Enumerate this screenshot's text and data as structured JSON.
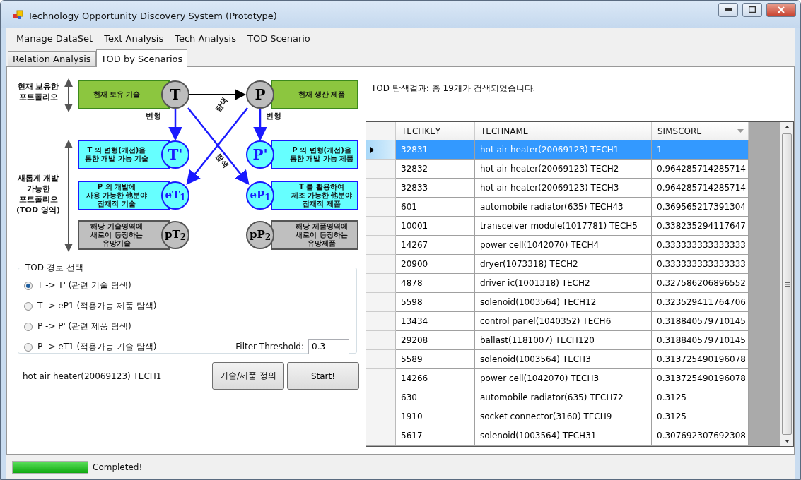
{
  "window": {
    "title": "Technology Opportunity Discovery System (Prototype)"
  },
  "menu": [
    "Manage DataSet",
    "Text Analysis",
    "Tech Analysis",
    "TOD Scenario"
  ],
  "tabs": [
    {
      "label": "Relation Analysis",
      "selected": false
    },
    {
      "label": "TOD by Scenarios",
      "selected": true
    }
  ],
  "diagram": {
    "side_labels": [
      "현재 보유한\n포트폴리오",
      "새롭게 개발\n가능한\n포트폴리오\n(TOD 영역)"
    ],
    "nodes": [
      {
        "kind": "current",
        "symbol": "T",
        "text": "현재 보유 기술"
      },
      {
        "kind": "current",
        "symbol": "P",
        "text": "현재 생산 제품"
      },
      {
        "kind": "variant",
        "symbol": "T'",
        "text": "T 의 변형(개선)을\n통한 개발 가능 기술"
      },
      {
        "kind": "variant",
        "symbol": "P'",
        "text": "P 의 변형(개선)을\n통한 개발 가능 제품"
      },
      {
        "kind": "variant",
        "symbol": "eT$_{1}$",
        "text": "P 의 개발에\n사용 가능한 他분야\n잠재적 기술"
      },
      {
        "kind": "variant",
        "symbol": "eP$_{1}$",
        "text": "T 를 활용하여\n제조 가능한 他분야\n잠재적 제품"
      },
      {
        "kind": "emerging",
        "symbol": "pT$_{2}$",
        "text": "해당 기술영역에\n새로이 등장하는\n유망기술"
      },
      {
        "kind": "emerging",
        "symbol": "pP$_{2}$",
        "text": "해당 제품영역에\n새로이 등장하는\n유망제품"
      }
    ],
    "edge_labels": [
      "변형",
      "변형",
      "탐색",
      "탐색"
    ]
  },
  "route_group": {
    "title": "TOD 경로 선택",
    "options": [
      {
        "label": "T -> T' (관련 기술 탐색)",
        "selected": true
      },
      {
        "label": "T -> eP1 (적용가능 제품 탐색)",
        "selected": false
      },
      {
        "label": "P -> P' (관련 제품 탐색)",
        "selected": false
      },
      {
        "label": "P -> eT1 (적용가능 기술 탐색)",
        "selected": false
      }
    ],
    "filter": {
      "label": "Filter Threshold:",
      "value": "0.3"
    }
  },
  "current_item": "hot air heater(20069123) TECH1",
  "buttons": [
    "기술/제품 정의",
    "Start!"
  ],
  "result_summary": "TOD 탐색결과: 총 19개가 검색되었습니다.",
  "table": {
    "columns": [
      {
        "label": "TECHKEY",
        "sorted": false
      },
      {
        "label": "TECHNAME",
        "sorted": false
      },
      {
        "label": "SIMSCORE",
        "sorted": true
      }
    ],
    "rows": [
      {
        "cells": [
          "32831",
          "hot air heater(20069123) TECH1",
          "1"
        ],
        "selected": true
      },
      {
        "cells": [
          "32832",
          "hot air heater(20069123) TECH2",
          "0.964285714285714"
        ],
        "selected": false
      },
      {
        "cells": [
          "32833",
          "hot air heater(20069123) TECH3",
          "0.964285714285714"
        ],
        "selected": false
      },
      {
        "cells": [
          "601",
          "automobile radiator(635) TECH43",
          "0.369565217391304"
        ],
        "selected": false
      },
      {
        "cells": [
          "10001",
          "transceiver module(1017781) TECH5",
          "0.338235294117647"
        ],
        "selected": false
      },
      {
        "cells": [
          "14267",
          "power cell(1042070) TECH4",
          "0.333333333333333"
        ],
        "selected": false
      },
      {
        "cells": [
          "20900",
          "dryer(1073318) TECH2",
          "0.333333333333333"
        ],
        "selected": false
      },
      {
        "cells": [
          "4878",
          "driver ic(1001318) TECH2",
          "0.327586206896552"
        ],
        "selected": false
      },
      {
        "cells": [
          "5598",
          "solenoid(1003564) TECH12",
          "0.323529411764706"
        ],
        "selected": false
      },
      {
        "cells": [
          "13434",
          "control panel(1040352) TECH6",
          "0.318840579710145"
        ],
        "selected": false
      },
      {
        "cells": [
          "29208",
          "ballast(1181007) TECH120",
          "0.318840579710145"
        ],
        "selected": false
      },
      {
        "cells": [
          "5589",
          "solenoid(1003564) TECH3",
          "0.313725490196078"
        ],
        "selected": false
      },
      {
        "cells": [
          "14266",
          "power cell(1042070) TECH3",
          "0.313725490196078"
        ],
        "selected": false
      },
      {
        "cells": [
          "630",
          "automobile radiator(635) TECH72",
          "0.3125"
        ],
        "selected": false
      },
      {
        "cells": [
          "1910",
          "socket connector(3160) TECH9",
          "0.3125"
        ],
        "selected": false
      },
      {
        "cells": [
          "5617",
          "solenoid(1003564) TECH31",
          "0.307692307692308"
        ],
        "selected": false
      }
    ]
  },
  "status_bar": {
    "progress": {
      "level": 1
    },
    "text": "Completed!"
  }
}
